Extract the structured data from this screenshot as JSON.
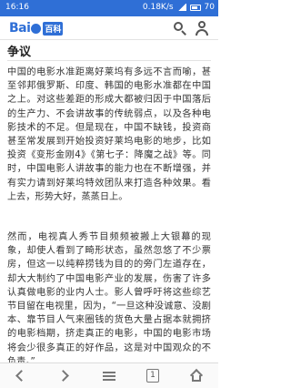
{
  "status_bar": {
    "time": "16:16",
    "data_speed": "0.18",
    "data_unit": "K/s",
    "battery": "70"
  },
  "header": {
    "logo_text": "Bai",
    "logo_badge": "百科"
  },
  "article": {
    "section_title": "争议",
    "paragraph_1": "中国的电影水准距离好莱坞有多远不言而喻，甚至邻邦俄罗斯、印度、韩国的电影水准都在中国之上。对这些差距的形成大都被归因于中国落后的生产力、不会讲故事的传统弱点，以及各种电影技术的不足。但是现在，中国不缺钱，投资商甚至常发展到开始投资好莱坞电影的地步，比如投资《变形金刚4》《第七子：降魔之战》等。同时，中国电影人讲故事的能力也在不断增强，并有实力请到好莱坞特效团队来打造各种效果。看上去，形势大好，蒸蒸日上。",
    "paragraph_2": "然而，电视真人秀节目频频被搬上大银幕的现象，却使人看到了畸形状态，虽然忽悠了不少票房，但这一以纯粹捞钱为目的的旁门左道存在，却大大制约了中国电影产业的发展，伤害了许多认真做电影的业内人士。影人曾呼吁将这些综艺节目留在电视里，因为，“一旦这种没诚意、没剧本、靠节目人气来圈钱的货色大量占据本就拥挤的电影档期，挤走真正的电影，中国的电影市场将会少很多真正的好作品，这是对中国观众的不负责。”"
  },
  "bottom_nav": {
    "back_icon": "chevron-left-icon",
    "forward_icon": "chevron-right-icon",
    "menu_icon": "menu-icon",
    "tabs_count": "1",
    "home_icon": "home-icon"
  },
  "colors": {
    "brand_blue": "#2f6fd6",
    "text": "#333333",
    "icon_gray": "#777777"
  }
}
